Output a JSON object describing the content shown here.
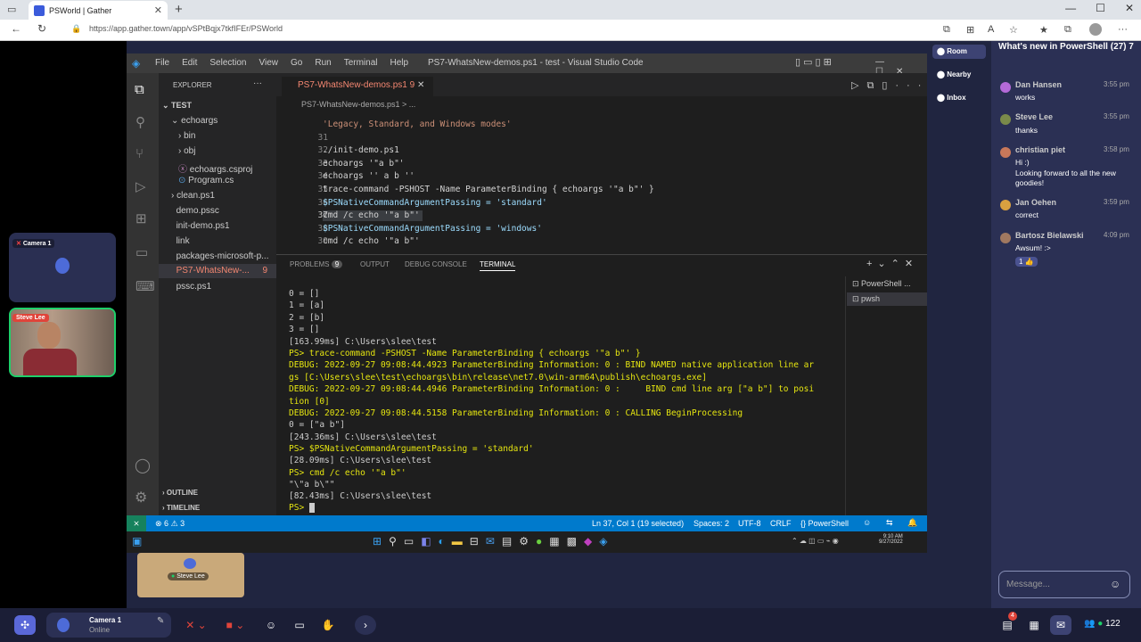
{
  "browser": {
    "tab_title": "PSWorld | Gather",
    "url": "https://app.gather.town/app/vSPtBqjx7tkfIFEr/PSWorld"
  },
  "vscode": {
    "menu": [
      "File",
      "Edit",
      "Selection",
      "View",
      "Go",
      "Run",
      "Terminal",
      "Help"
    ],
    "window_title": "PS7-WhatsNew-demos.ps1 - test - Visual Studio Code",
    "explorer_label": "EXPLORER",
    "tree": [
      "TEST",
      "echoargs",
      "bin",
      "obj",
      "echoargs.csproj",
      "Program.cs",
      "clean.ps1",
      "demo.pssc",
      "init-demo.ps1",
      "link",
      "packages-microsoft-p...",
      "PS7-WhatsNew-...",
      "pssc.ps1"
    ],
    "tree_badge": "9",
    "outline": "OUTLINE",
    "timeline": "TIMELINE",
    "tab_label": "PS7-WhatsNew-demos.ps1",
    "tab_badge": "9",
    "breadcrumb": "PS7-WhatsNew-demos.ps1 > ...",
    "lines": [
      {
        "n": "",
        "t": "'Legacy, Standard, and Windows modes'"
      },
      {
        "n": "31",
        "t": ""
      },
      {
        "n": "32",
        "t": "./init-demo.ps1"
      },
      {
        "n": "33",
        "t": "echoargs '\"a b\"'"
      },
      {
        "n": "34",
        "t": "echoargs '' a b ''"
      },
      {
        "n": "35",
        "t": "trace-command -PSHOST -Name ParameterBinding { echoargs '\"a b\"' }"
      },
      {
        "n": "36",
        "t": "$PSNativeCommandArgumentPassing = 'standard'"
      },
      {
        "n": "37",
        "t": "cmd /c echo '\"a b\"'"
      },
      {
        "n": "38",
        "t": "$PSNativeCommandArgumentPassing = 'windows'"
      },
      {
        "n": "39",
        "t": "cmd /c echo '\"a b\"'"
      }
    ],
    "panel_tabs": [
      "PROBLEMS",
      "OUTPUT",
      "DEBUG CONSOLE",
      "TERMINAL"
    ],
    "problems_count": "9",
    "terminal_list": [
      "PowerShell ...",
      "pwsh"
    ],
    "terminal": [
      "0 = []",
      "1 = [a]",
      "2 = [b]",
      "3 = []",
      "[163.99ms] C:\\Users\\slee\\test",
      "PS> trace-command -PSHOST -Name ParameterBinding { echoargs '\"a b\"' }",
      "DEBUG: 2022-09-27 09:08:44.4923 ParameterBinding Information: 0 : BIND NAMED native application line ar",
      "gs [C:\\Users\\slee\\test\\echoargs\\bin\\release\\net7.0\\win-arm64\\publish\\echoargs.exe]",
      "DEBUG: 2022-09-27 09:08:44.4946 ParameterBinding Information: 0 :     BIND cmd line arg [\"a b\"] to posi",
      "tion [0]",
      "DEBUG: 2022-09-27 09:08:44.5158 ParameterBinding Information: 0 : CALLING BeginProcessing",
      "0 = [\"a b\"]",
      "[243.36ms] C:\\Users\\slee\\test",
      "PS> $PSNativeCommandArgumentPassing = 'standard'",
      "[28.09ms] C:\\Users\\slee\\test",
      "PS> cmd /c echo '\"a b\"'",
      "\"\\\"a b\\\"\"",
      "[82.43ms] C:\\Users\\slee\\test",
      "PS> "
    ],
    "status": {
      "errors": "6",
      "warnings": "3",
      "position": "Ln 37, Col 1 (19 selected)",
      "spaces": "Spaces: 2",
      "encoding": "UTF-8",
      "eol": "CRLF",
      "lang": "PowerShell"
    },
    "clock": {
      "time": "9:10 AM",
      "date": "9/27/2022"
    }
  },
  "gather": {
    "camera1": "Camera 1",
    "steve": "Steve Lee",
    "map_name": "Steve Lee",
    "nav": [
      "Room",
      "Nearby",
      "Inbox"
    ],
    "chat_title": "What's new in PowerShell  (27) 7",
    "messages": [
      {
        "name": "Dan Hansen",
        "time": "3:55 pm",
        "text": "works",
        "color": "#b46ad8"
      },
      {
        "name": "Steve Lee",
        "time": "3:55 pm",
        "text": "thanks",
        "color": "#7a8a4a"
      },
      {
        "name": "christian piet",
        "time": "3:58 pm",
        "text": "Hi :)",
        "text2": "Looking forward to all the new",
        "text3": "goodies!",
        "color": "#c8785a"
      },
      {
        "name": "Jan Oehen",
        "time": "3:59 pm",
        "text": "correct",
        "color": "#d8a040"
      },
      {
        "name": "Bartosz Bielawski",
        "time": "4:09 pm",
        "text": "Awsum! :>",
        "color": "#a07860"
      }
    ],
    "reaction": "1 👍",
    "message_placeholder": "Message...",
    "user_name": "Camera 1",
    "user_status": "Online",
    "online_count": "122",
    "notif_count": "4"
  }
}
